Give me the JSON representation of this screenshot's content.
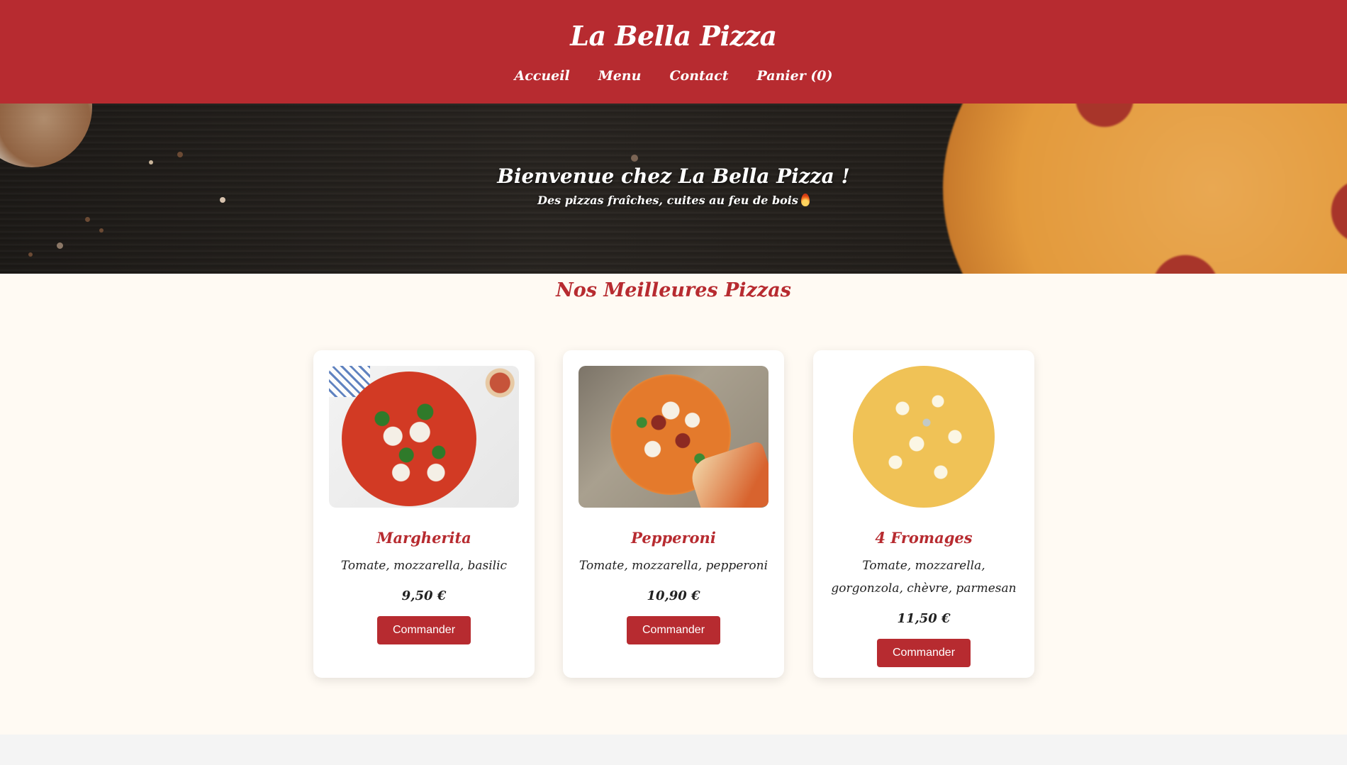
{
  "header": {
    "brand": "La Bella Pizza",
    "nav": [
      "Accueil",
      "Menu",
      "Contact",
      "Panier (0)"
    ]
  },
  "hero": {
    "title": "Bienvenue chez La Bella Pizza !",
    "subtitle": "Des pizzas fraîches, cuites au feu de bois",
    "subtitle_icon": "fire-icon"
  },
  "section": {
    "title": "Nos Meilleures Pizzas"
  },
  "pizzas": [
    {
      "name": "Margherita",
      "description": "Tomate, mozzarella, basilic",
      "price": "9,50 €",
      "button": "Commander"
    },
    {
      "name": "Pepperoni",
      "description": "Tomate, mozzarella, pepperoni",
      "price": "10,90 €",
      "button": "Commander"
    },
    {
      "name": "4 Fromages",
      "description": "Tomate, mozzarella, gorgonzola, chèvre, parmesan",
      "price": "11,50 €",
      "button": "Commander"
    }
  ],
  "colors": {
    "brand_red": "#b72b30",
    "page_bg": "#fffaf3"
  }
}
